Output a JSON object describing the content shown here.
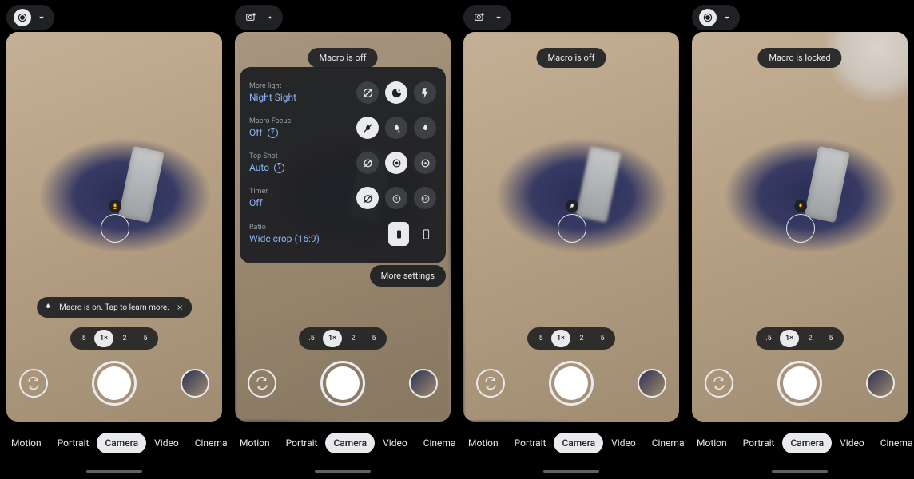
{
  "modes": [
    "Motion",
    "Portrait",
    "Camera",
    "Video",
    "Cinema"
  ],
  "active_mode": "Camera",
  "zoom": {
    "options": [
      ".5",
      "1×",
      "2",
      "5"
    ],
    "active": "1×"
  },
  "phones": [
    {
      "id": "p1",
      "chev": "down",
      "toast": null,
      "snack": {
        "text": "Macro is on. Tap to learn more."
      },
      "focus_icon": "macro-gold",
      "topbar_icon": "lens"
    },
    {
      "id": "p2",
      "chev": "up",
      "toast": "Macro is off",
      "snack": null,
      "focus_icon": null,
      "topbar_icon": "settings-gear",
      "sheet": {
        "more_light": {
          "label": "More light",
          "value": "Night Sight"
        },
        "macro_focus": {
          "label": "Macro Focus",
          "value": "Off"
        },
        "top_shot": {
          "label": "Top Shot",
          "value": "Auto"
        },
        "timer": {
          "label": "Timer",
          "value": "Off"
        },
        "ratio": {
          "label": "Ratio",
          "value": "Wide crop (16:9)"
        }
      },
      "more_settings": "More settings"
    },
    {
      "id": "p3",
      "chev": "down",
      "toast": "Macro is off",
      "snack": null,
      "focus_icon": "macro-slash",
      "topbar_icon": "settings-gear"
    },
    {
      "id": "p4",
      "chev": "down",
      "toast": "Macro is locked",
      "snack": null,
      "focus_icon": "macro-gold",
      "topbar_icon": "lens"
    }
  ]
}
